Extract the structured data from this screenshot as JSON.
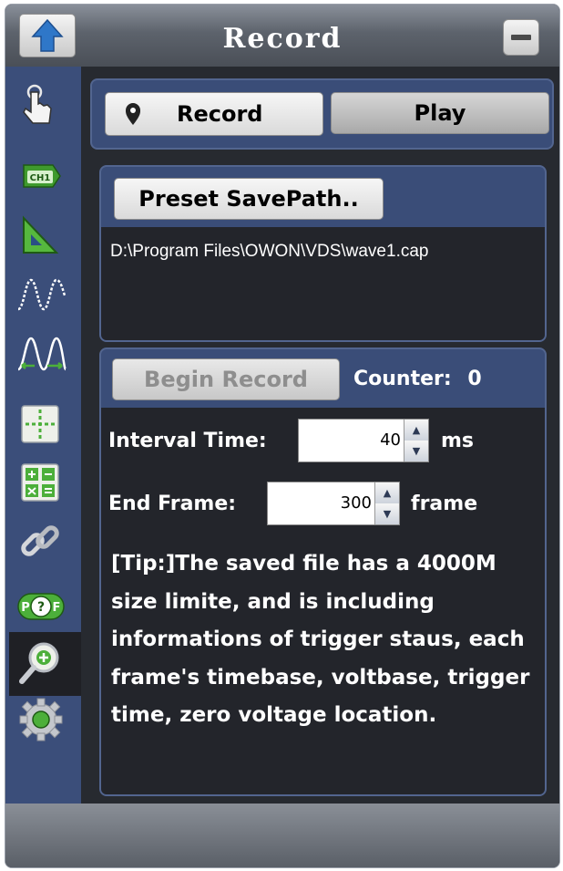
{
  "window": {
    "title": "Record"
  },
  "tabs": {
    "record_label": "Record",
    "play_label": "Play"
  },
  "save_path": {
    "button_label": "Preset SavePath..",
    "path_text": "D:\\Program Files\\OWON\\VDS\\wave1.cap"
  },
  "recording": {
    "begin_label": "Begin Record",
    "counter_label": "Counter:",
    "counter_value": "0",
    "interval_label": "Interval Time:",
    "interval_value": "40",
    "interval_unit": "ms",
    "end_frame_label": "End Frame:",
    "end_frame_value": "300",
    "end_frame_unit": "frame",
    "tip": "[Tip:]The saved file has a 4000M\nsize limite, and is including\ninformations of trigger staus, each\nframe's timebase, voltbase, trigger\ntime, zero voltage location."
  },
  "sidebar": {
    "icons": [
      "touch-icon",
      "channel-ch1-icon",
      "trigger-icon",
      "waveform-icon",
      "measure-waveform-icon",
      "cursor-icon",
      "math-icon",
      "link-icon",
      "pass-fail-icon",
      "record-zoom-icon",
      "settings-gear-icon"
    ],
    "ch1_text": "CH1",
    "pf_text_p": "P",
    "pf_text_q": "?",
    "pf_text_f": "F",
    "active_item": "record-zoom-icon"
  },
  "colors": {
    "titlebar": "#5d636c",
    "sidebar": "#3b4e7a",
    "panel": "#3a4d78",
    "content_dark": "#23252b",
    "icon_green": "#4caf3a"
  }
}
